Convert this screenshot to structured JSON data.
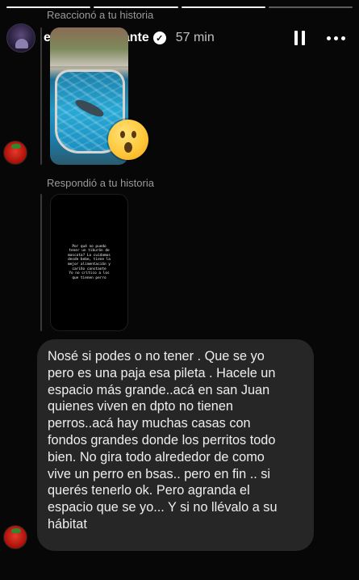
{
  "story": {
    "progress_segments": [
      {
        "state": "done"
      },
      {
        "state": "done"
      },
      {
        "state": "done"
      },
      {
        "state": "upcoming"
      }
    ]
  },
  "header": {
    "username": "elefantediamante",
    "verified": true,
    "time": "57 min"
  },
  "thread": {
    "reaction_label": "Reaccionó a tu historia",
    "reaction_emoji": "surprised-face",
    "reply_label": "Respondió a tu historia",
    "story_text": "Por qué no puedo\ntener un tiburón de\nmascota? Lo cuidamos\ndesde bebe, tiene la\nmejor alimentación y\ncariño constante\nYo no critico a los\nque tienen perro",
    "message": "Nosé si podes o no tener . Que se yo\npero es una paja esa pileta . Hacele un\nespacio más grande..acá en san Juan\nquienes viven en dpto no tienen\nperros..acá hay muchas casas con\nfondos grandes donde los perritos todo\nbien. No gira todo alrededor de como\nvive un perro en bsas.. pero en fin .. si\nquerés tenerlo ok. Pero agranda el\nespacio que se yo... Y si no llévalo a su\nhábitat"
  },
  "colors": {
    "background": "#070707",
    "bubble": "#262626",
    "secondary_text": "#9a9a9a"
  }
}
